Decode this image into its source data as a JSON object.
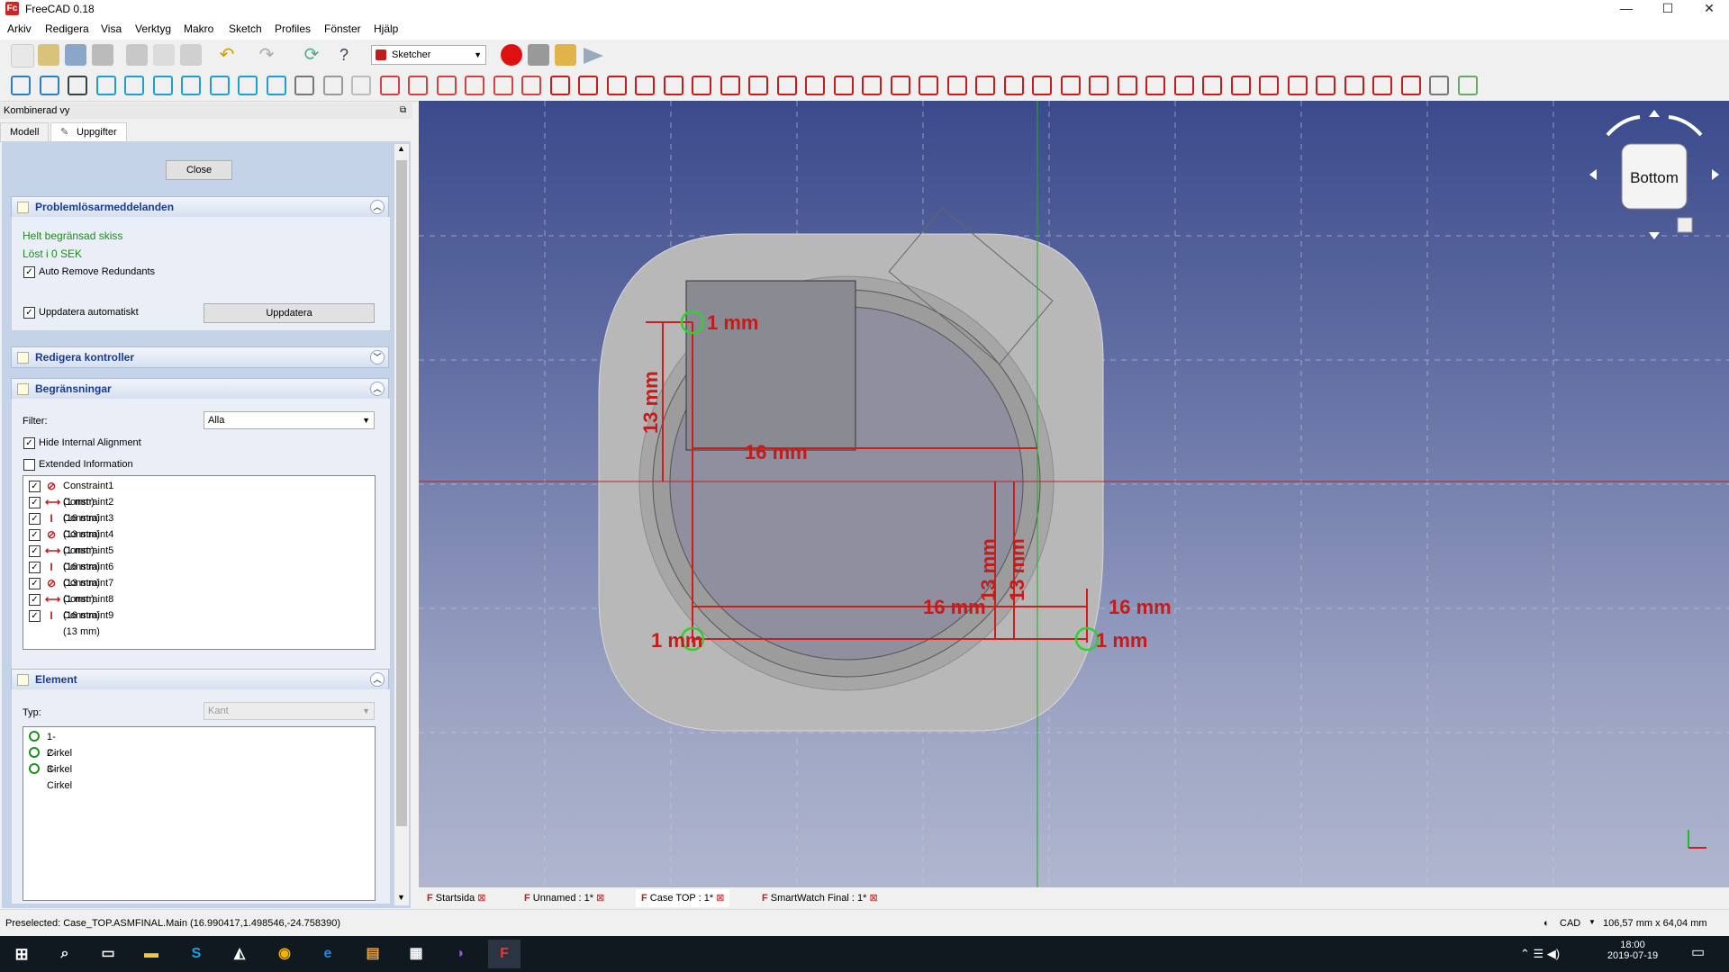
{
  "window": {
    "title": "FreeCAD 0.18",
    "logo": "Fc"
  },
  "menu": [
    "Arkiv",
    "Redigera",
    "Visa",
    "Verktyg",
    "Makro",
    "Sketch",
    "Profiles",
    "Fönster",
    "Hjälp"
  ],
  "workbench": {
    "selected": "Sketcher"
  },
  "combo_view": {
    "title": "Kombinerad vy",
    "tabs": [
      "Modell",
      "Uppgifter"
    ],
    "active_tab": "Uppgifter",
    "close_label": "Close"
  },
  "solver": {
    "title": "Problemlösarmeddelanden",
    "status": "Helt begränsad skiss",
    "time": "Löst i 0 SEK",
    "auto_remove_label": "Auto Remove Redundants",
    "auto_update_label": "Uppdatera automatiskt",
    "update_button": "Uppdatera"
  },
  "edit_controls": {
    "title": "Redigera kontroller"
  },
  "constraints": {
    "title": "Begränsningar",
    "filter_label": "Filter:",
    "filter_value": "Alla",
    "hide_internal_label": "Hide Internal Alignment",
    "extended_info_label": "Extended Information",
    "items": [
      {
        "label": "Constraint1 (1 mm)",
        "icon": "radius-icon",
        "glyph": "⊘"
      },
      {
        "label": "Constraint2 (16 mm)",
        "icon": "horizontal-distance-icon",
        "glyph": "⟷"
      },
      {
        "label": "Constraint3 (13 mm)",
        "icon": "vertical-distance-icon",
        "glyph": "I"
      },
      {
        "label": "Constraint4 (1 mm)",
        "icon": "radius-icon",
        "glyph": "⊘"
      },
      {
        "label": "Constraint5 (16 mm)",
        "icon": "horizontal-distance-icon",
        "glyph": "⟷"
      },
      {
        "label": "Constraint6 (13 mm)",
        "icon": "vertical-distance-icon",
        "glyph": "I"
      },
      {
        "label": "Constraint7 (1 mm)",
        "icon": "radius-icon",
        "glyph": "⊘"
      },
      {
        "label": "Constraint8 (16 mm)",
        "icon": "horizontal-distance-icon",
        "glyph": "⟷"
      },
      {
        "label": "Constraint9 (13 mm)",
        "icon": "vertical-distance-icon",
        "glyph": "I"
      }
    ]
  },
  "element": {
    "title": "Element",
    "type_label": "Typ:",
    "type_value": "Kant",
    "items": [
      "1-Cirkel",
      "2-Cirkel",
      "3-Cirkel"
    ]
  },
  "viewport": {
    "navcube_face": "Bottom",
    "dimensions": {
      "r1": "1 mm",
      "v13": "13 mm",
      "h16": "16 mm"
    }
  },
  "doc_tabs": [
    "Startsida",
    "Unnamed : 1*",
    "Case TOP : 1*",
    "SmartWatch Final : 1*"
  ],
  "doc_tab_active": "Case TOP : 1*",
  "status": {
    "preselected": "Preselected: Case_TOP.ASMFINAL.Main (16.990417,1.498546,-24.758390)",
    "nav_style": "CAD",
    "dimensions": "106,57 mm x 64,04 mm"
  },
  "taskbar": {
    "time": "18:00",
    "date": "2019-07-19"
  }
}
